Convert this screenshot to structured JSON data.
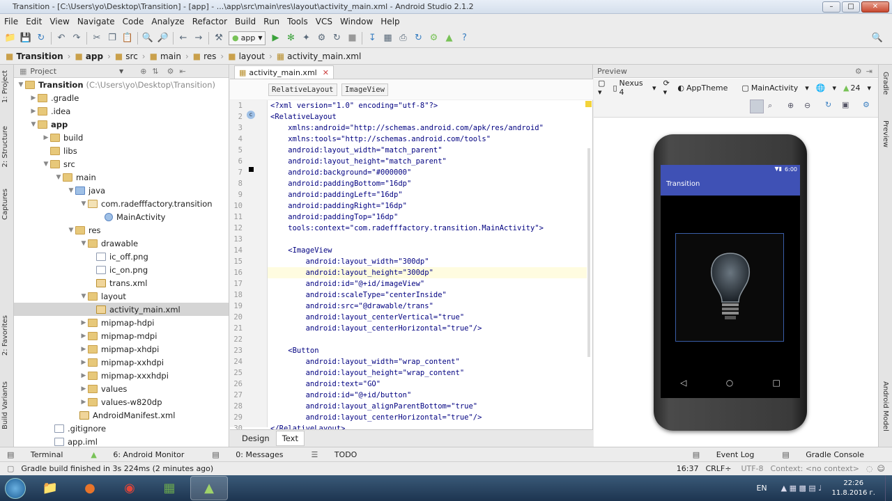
{
  "window": {
    "title": "Transition - [C:\\Users\\yo\\Desktop\\Transition] - [app] - ...\\app\\src\\main\\res\\layout\\activity_main.xml - Android Studio 2.1.2"
  },
  "menu": [
    "File",
    "Edit",
    "View",
    "Navigate",
    "Code",
    "Analyze",
    "Refactor",
    "Build",
    "Run",
    "Tools",
    "VCS",
    "Window",
    "Help"
  ],
  "toolbar": {
    "run_config": "app"
  },
  "breadcrumbs": [
    "Transition",
    "app",
    "src",
    "main",
    "res",
    "layout",
    "activity_main.xml"
  ],
  "left_tabs": [
    "1: Project",
    "2: Structure",
    "Captures",
    "2: Favorites",
    "Build Variants"
  ],
  "project": {
    "header": "Project",
    "tree": [
      {
        "label": "Transition",
        "extra": "(C:\\Users\\yo\\Desktop\\Transition)",
        "icon": "folder-icon"
      },
      {
        "label": ".gradle",
        "icon": "folder-icon"
      },
      {
        "label": ".idea",
        "icon": "folder-icon"
      },
      {
        "label": "app",
        "icon": "folder-icon"
      },
      {
        "label": "build",
        "icon": "folder-icon"
      },
      {
        "label": "libs",
        "icon": "folder-icon"
      },
      {
        "label": "src",
        "icon": "folder-icon"
      },
      {
        "label": "main",
        "icon": "folder-icon"
      },
      {
        "label": "java",
        "icon": "folder-icon"
      },
      {
        "label": "com.radefffactory.transition",
        "icon": "package-icon"
      },
      {
        "label": "MainActivity",
        "icon": "class-icon"
      },
      {
        "label": "res",
        "icon": "folder-icon"
      },
      {
        "label": "drawable",
        "icon": "folder-icon"
      },
      {
        "label": "ic_off.png",
        "icon": "file-icon"
      },
      {
        "label": "ic_on.png",
        "icon": "file-icon"
      },
      {
        "label": "trans.xml",
        "icon": "xml-file-icon"
      },
      {
        "label": "layout",
        "icon": "folder-icon"
      },
      {
        "label": "activity_main.xml",
        "icon": "xml-file-icon"
      },
      {
        "label": "mipmap-hdpi",
        "icon": "folder-icon"
      },
      {
        "label": "mipmap-mdpi",
        "icon": "folder-icon"
      },
      {
        "label": "mipmap-xhdpi",
        "icon": "folder-icon"
      },
      {
        "label": "mipmap-xxhdpi",
        "icon": "folder-icon"
      },
      {
        "label": "mipmap-xxxhdpi",
        "icon": "folder-icon"
      },
      {
        "label": "values",
        "icon": "folder-icon"
      },
      {
        "label": "values-w820dp",
        "icon": "folder-icon"
      },
      {
        "label": "AndroidManifest.xml",
        "icon": "xml-file-icon"
      },
      {
        "label": ".gitignore",
        "icon": "file-icon"
      },
      {
        "label": "app.iml",
        "icon": "file-icon"
      }
    ]
  },
  "editor": {
    "tab": "activity_main.xml",
    "crumb_tags": [
      "RelativeLayout",
      "ImageView"
    ],
    "line_numbers": [
      "1",
      "2",
      "3",
      "4",
      "5",
      "6",
      "7",
      "8",
      "9",
      "10",
      "11",
      "12",
      "13",
      "14",
      "15",
      "16",
      "17",
      "18",
      "19",
      "20",
      "21",
      "22",
      "23",
      "24",
      "25",
      "26",
      "27",
      "28",
      "29",
      "30"
    ],
    "lines": [
      "<?xml version=\"1.0\" encoding=\"utf-8\"?>",
      "<RelativeLayout",
      "    xmlns:android=\"http://schemas.android.com/apk/res/android\"",
      "    xmlns:tools=\"http://schemas.android.com/tools\"",
      "    android:layout_width=\"match_parent\"",
      "    android:layout_height=\"match_parent\"",
      "    android:background=\"#000000\"",
      "    android:paddingBottom=\"16dp\"",
      "    android:paddingLeft=\"16dp\"",
      "    android:paddingRight=\"16dp\"",
      "    android:paddingTop=\"16dp\"",
      "    tools:context=\"com.radefffactory.transition.MainActivity\">",
      "",
      "    <ImageView",
      "        android:layout_width=\"300dp\"",
      "        android:layout_height=\"300dp\"",
      "        android:id=\"@+id/imageView\"",
      "        android:scaleType=\"centerInside\"",
      "        android:src=\"@drawable/trans\"",
      "        android:layout_centerVertical=\"true\"",
      "        android:layout_centerHorizontal=\"true\"/>",
      "",
      "    <Button",
      "        android:layout_width=\"wrap_content\"",
      "        android:layout_height=\"wrap_content\"",
      "        android:text=\"GO\"",
      "        android:id=\"@+id/button\"",
      "        android:layout_alignParentBottom=\"true\"",
      "        android:layout_centerHorizontal=\"true\"/>",
      "</RelativeLayout>"
    ],
    "bottom_tabs": [
      "Design",
      "Text"
    ]
  },
  "preview": {
    "header": "Preview",
    "device": "Nexus 4",
    "theme": "AppTheme",
    "activity": "MainActivity",
    "api": "24",
    "app_title": "Transition",
    "clock": "6:00"
  },
  "right_tabs": [
    "Gradle",
    "Preview",
    "Android Model"
  ],
  "tool_windows": [
    "Terminal",
    "6: Android Monitor",
    "0: Messages",
    "TODO"
  ],
  "tool_windows_right": [
    "Event Log",
    "Gradle Console"
  ],
  "status": {
    "message": "Gradle build finished in 3s 224ms (2 minutes ago)",
    "position": "16:37",
    "line_sep": "CRLF÷",
    "encoding": "UTF-8",
    "context": "Context: <no context>"
  },
  "taskbar": {
    "lang": "EN",
    "time": "22:26",
    "date": "11.8.2016 г."
  }
}
